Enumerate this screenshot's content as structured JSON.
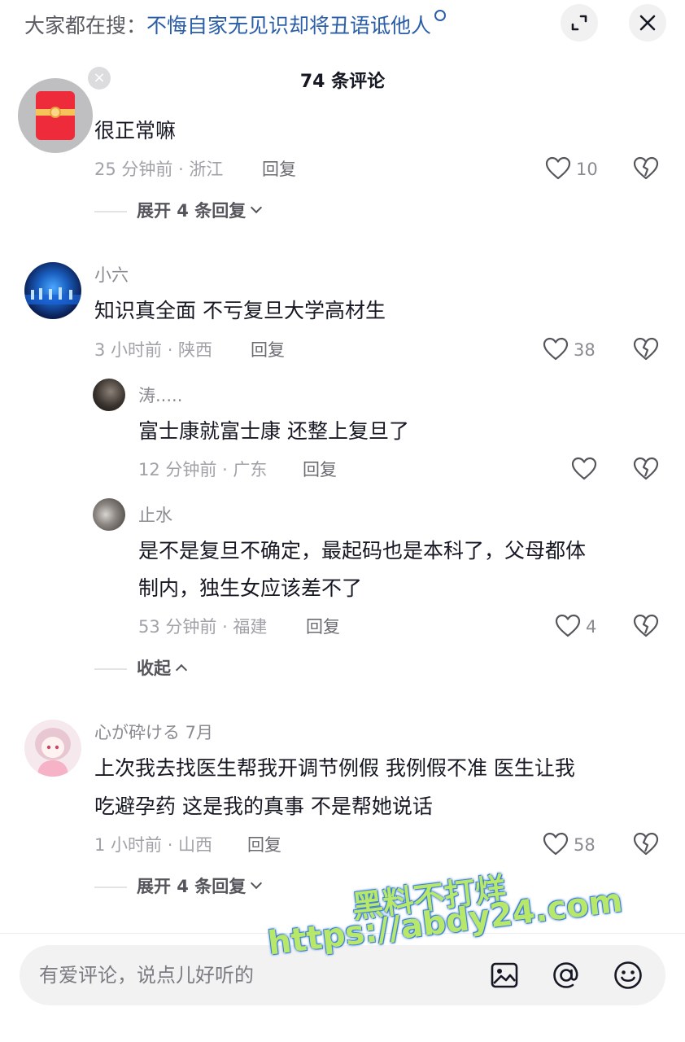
{
  "header": {
    "hot_search_prefix": "大家都在搜：",
    "hot_search_keyword": "不悔自家无见识却将丑语诋他人",
    "expand_icon": "expand-icon",
    "close_icon": "close-icon"
  },
  "comment_count": "74 条评论",
  "comments": [
    {
      "avatar": "red-packet-avatar",
      "nickname": "",
      "text": "很正常嘛",
      "meta": "25 分钟前 · 浙江",
      "reply": "回复",
      "likes": "10",
      "expand": "展开 4 条回复"
    },
    {
      "avatar": "blue-stage-avatar",
      "nickname": "小六",
      "text": "知识真全面 不亏复旦大学高材生",
      "meta": "3 小时前 · 陕西",
      "reply": "回复",
      "likes": "38",
      "replies": [
        {
          "nickname": "涛.....",
          "text": "富士康就富士康   还整上复旦了",
          "meta": "12 分钟前 · 广东",
          "reply": "回复",
          "likes": ""
        },
        {
          "nickname": "止水",
          "text_line1": "是不是复旦不确定，最起码也是本科了，父母都体",
          "text_line2": "制内，独生女应该差不了",
          "meta": "53 分钟前 · 福建",
          "reply": "回复",
          "likes": "4"
        }
      ],
      "collapse": "收起"
    },
    {
      "avatar": "anime-girl-avatar",
      "nickname": "心が砕ける 7月",
      "text_line1": "上次我去找医生帮我开调节例假  我例假不准  医生让我",
      "text_line2": "吃避孕药  这是我的真事  不是帮她说话",
      "meta": "1 小时前 · 山西",
      "reply": "回复",
      "likes": "58",
      "expand": "展开 4 条回复"
    }
  ],
  "input": {
    "placeholder": "有爱评论，说点儿好听的"
  },
  "watermark": {
    "line1": "黑料不打烊",
    "line2": "https://abdy24.com"
  },
  "colors": {
    "keyword": "#2a5ea8",
    "text": "#161823",
    "meta": "#a1a2a8",
    "watermark_fill": "#b8e86a",
    "watermark_stroke": "#3d7fd6"
  }
}
